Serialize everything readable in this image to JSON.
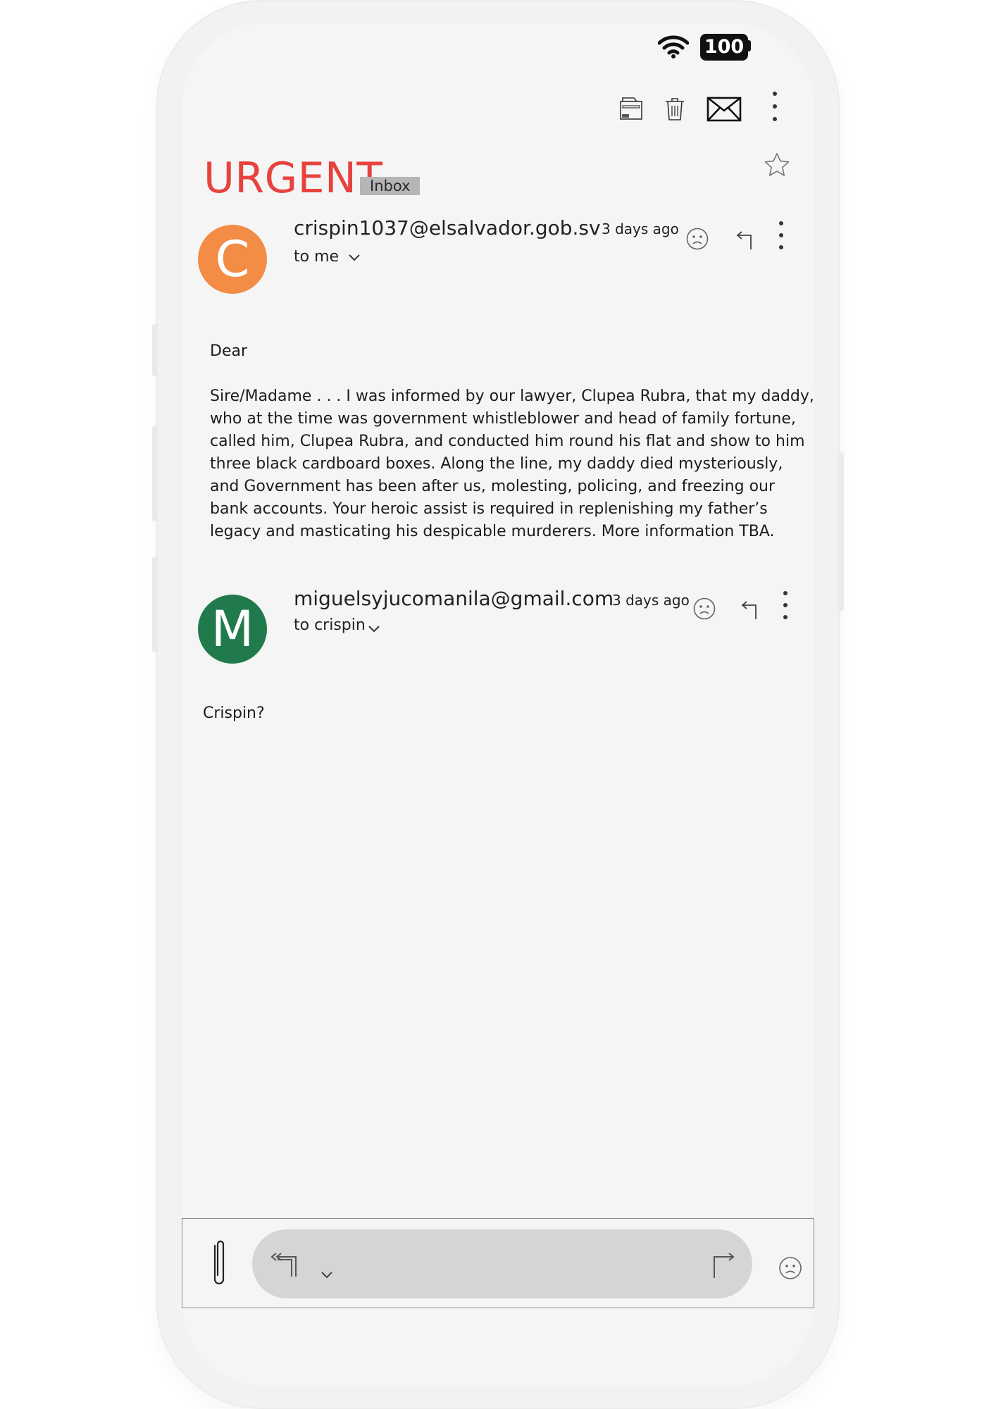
{
  "status_bar": {
    "battery": "100",
    "wifi_icon": "wifi-icon"
  },
  "toolbar": {
    "actions": [
      {
        "name": "archive",
        "icon": "archive-folder-icon"
      },
      {
        "name": "delete",
        "icon": "trash-icon"
      },
      {
        "name": "mark-unread",
        "icon": "envelope-icon"
      },
      {
        "name": "more",
        "icon": "more-vertical-icon"
      }
    ]
  },
  "thread": {
    "subject": "URGENT",
    "label": "Inbox",
    "starred": false
  },
  "messages": [
    {
      "avatar_letter": "C",
      "avatar_color": "#f38c45",
      "sender": "crispin1037@elsalvador.gob.sv",
      "recipient": "to me",
      "time": "3 days ago",
      "body": [
        "Dear",
        "",
        "Sire/Madame . . . I was informed by our lawyer, Clupea Rubra, that my daddy,",
        "who at the time was government whistleblower and head of family fortune,",
        "called him, Clupea Rubra, and conducted him round his flat and show to him",
        "three black cardboard boxes. Along the line, my daddy died mysteriously,",
        "and Government has been after us, molesting, policing, and freezing our",
        "bank accounts. Your heroic assist is required in replenishing my father’s",
        "legacy and masticating his despicable murderers. More information TBA."
      ]
    },
    {
      "avatar_letter": "M",
      "avatar_color": "#217a4b",
      "sender": "miguelsyjucomanila@gmail.com",
      "recipient": "to crispin",
      "time": "3 days ago",
      "body": [
        "Crispin?"
      ]
    }
  ],
  "composer": {
    "attach_icon": "paperclip-icon",
    "reply_all_icon": "reply-all-icon",
    "forward_icon": "forward-icon",
    "emoji_icon": "sad-face-icon"
  }
}
